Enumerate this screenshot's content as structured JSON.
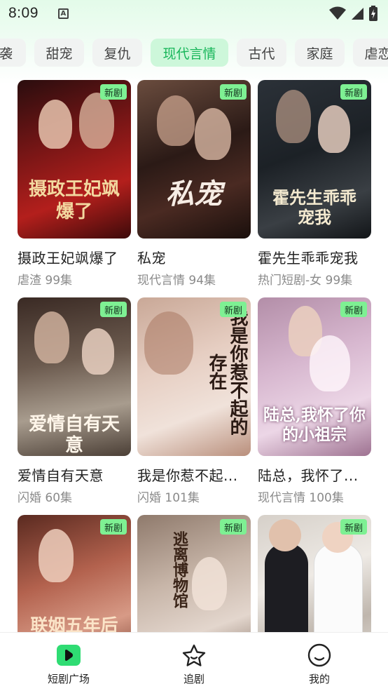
{
  "status_bar": {
    "time": "8:09"
  },
  "tabs": [
    {
      "label": "袭"
    },
    {
      "label": "甜宠"
    },
    {
      "label": "复仇"
    },
    {
      "label": "现代言情",
      "active": true
    },
    {
      "label": "古代"
    },
    {
      "label": "家庭"
    },
    {
      "label": "虐恋"
    }
  ],
  "cards": [
    {
      "badge": "新剧",
      "title": "摄政王妃飒爆了",
      "meta": "虐渣 99集",
      "poster_text": "摄政王妃飒爆了"
    },
    {
      "badge": "新剧",
      "title": "私宠",
      "meta": "现代言情 94集",
      "poster_text": "私宠"
    },
    {
      "badge": "新剧",
      "title": "霍先生乖乖宠我",
      "meta": "热门短剧-女 99集",
      "poster_text": "霍先生乖乖宠我"
    },
    {
      "badge": "新剧",
      "title": "爱情自有天意",
      "meta": "闪婚 60集",
      "poster_text": "爱情自有天意"
    },
    {
      "badge": "新剧",
      "title": "我是你惹不起...",
      "meta": "闪婚 101集",
      "poster_text": "我是你惹不起的存在"
    },
    {
      "badge": "新剧",
      "title": "陆总，我怀了...",
      "meta": "现代言情 100集",
      "poster_text": "陆总,我怀了你的小祖宗"
    },
    {
      "badge": "新剧",
      "title": "",
      "meta": "",
      "poster_text": "联姻五年后"
    },
    {
      "badge": "新剧",
      "title": "",
      "meta": "",
      "poster_text": "逃离博物馆"
    },
    {
      "badge": "新剧",
      "title": "",
      "meta": "",
      "poster_text": ""
    }
  ],
  "bottom_nav": [
    {
      "label": "短剧广场",
      "icon": "play-icon",
      "active": true
    },
    {
      "label": "追剧",
      "icon": "star-icon"
    },
    {
      "label": "我的",
      "icon": "smile-icon"
    }
  ],
  "colors": {
    "accent": "#18b65a",
    "active_tab_bg": "#cdf7da",
    "badge_bg": "#7ef093"
  }
}
